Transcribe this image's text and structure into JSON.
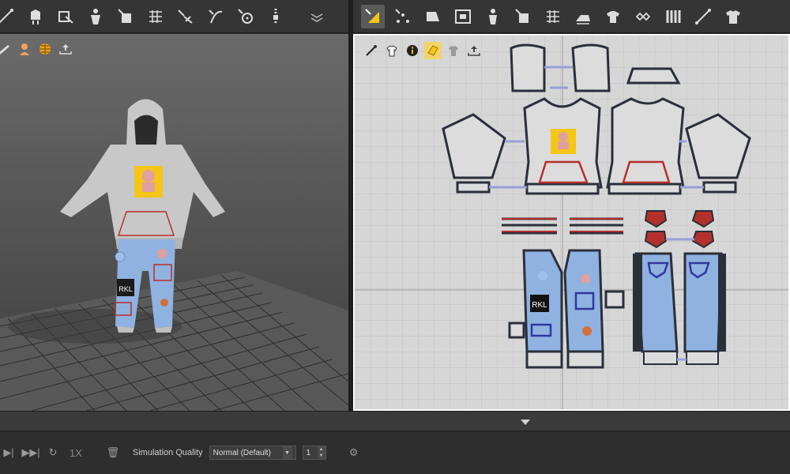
{
  "left_toolbar": {
    "tools": [
      {
        "name": "draw-line-icon"
      },
      {
        "name": "avatar-pose-icon"
      },
      {
        "name": "garment-select-icon"
      },
      {
        "name": "avatar-arrange-icon"
      },
      {
        "name": "pin-tool-icon"
      },
      {
        "name": "mesh-grid-icon"
      },
      {
        "name": "tack-tool-icon"
      },
      {
        "name": "zipper-tool-icon"
      },
      {
        "name": "button-tool-icon"
      },
      {
        "name": "zipper-pull-icon"
      }
    ]
  },
  "right_toolbar": {
    "tools": [
      {
        "name": "edit-pattern-icon",
        "active": true
      },
      {
        "name": "edit-points-icon"
      },
      {
        "name": "polygon-tool-icon"
      },
      {
        "name": "internal-polygon-icon"
      },
      {
        "name": "avatar-arrange-icon"
      },
      {
        "name": "pin-tool-icon"
      },
      {
        "name": "mesh-grid-icon"
      },
      {
        "name": "iron-tool-icon"
      },
      {
        "name": "garment-fold-icon"
      },
      {
        "name": "smocking-icon"
      },
      {
        "name": "pleat-tool-icon"
      },
      {
        "name": "measure-line-icon"
      },
      {
        "name": "tshirt-icon"
      }
    ]
  },
  "viewport3d": {
    "mini_tools": [
      {
        "name": "fabric-display-icon"
      },
      {
        "name": "avatar-display-icon"
      },
      {
        "name": "texture-display-icon"
      },
      {
        "name": "export-icon"
      }
    ],
    "patch_text": "RKL"
  },
  "viewport2d": {
    "mini_tools": [
      {
        "name": "brush-tool-icon"
      },
      {
        "name": "garment-display-icon"
      },
      {
        "name": "info-icon"
      },
      {
        "name": "texture-display-icon",
        "active": true
      },
      {
        "name": "shirt-display-icon"
      },
      {
        "name": "export-icon"
      }
    ],
    "patch_text": "RKL"
  },
  "bottom_bar": {
    "speed": "1X",
    "simulation_quality_label": "Simulation Quality",
    "quality_value": "Normal (Default)",
    "step_value": "1"
  },
  "colors": {
    "accent_yellow": "#f5c518",
    "pattern_outline": "#2a2f3a",
    "denim_blue": "#8fb2e0",
    "hoodie_gray": "#c8c8c8",
    "seam_red": "#b3302d",
    "seam_blue": "#9a9ed8"
  }
}
